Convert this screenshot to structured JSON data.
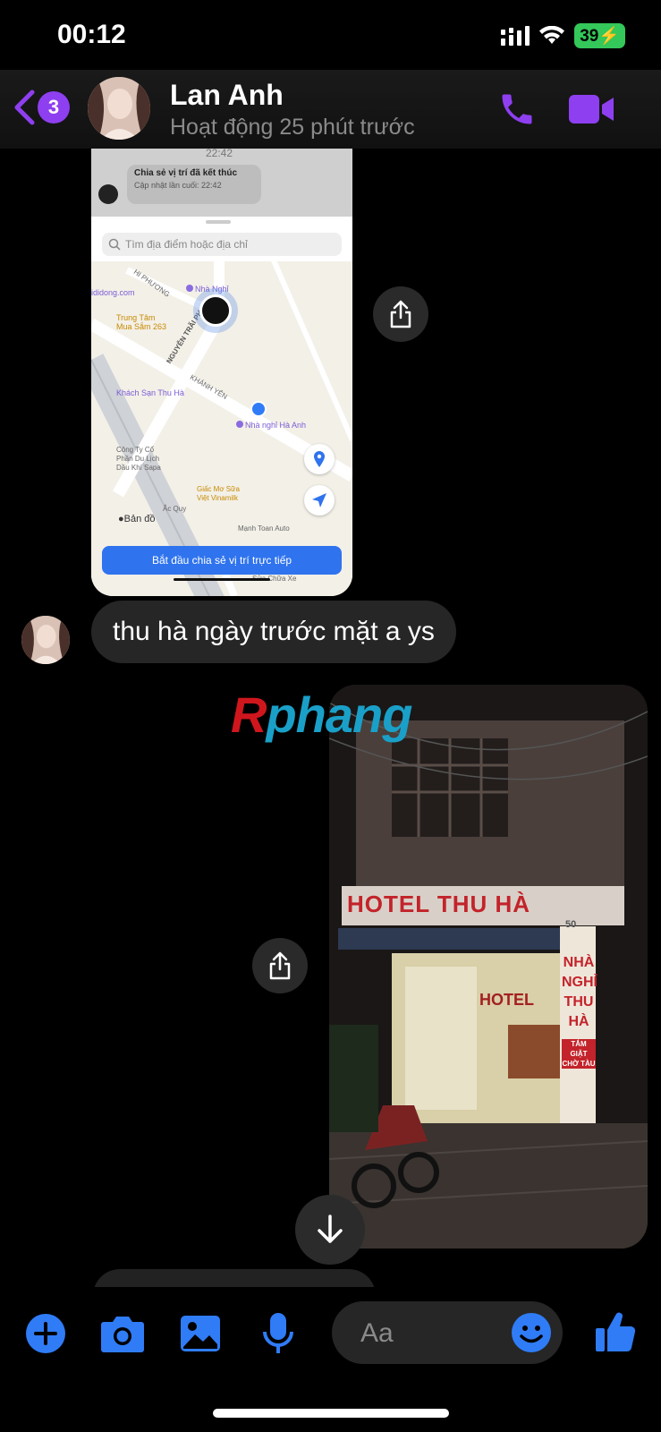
{
  "status_bar": {
    "time": "00:12",
    "battery": "39"
  },
  "header": {
    "back_badge": "3",
    "contact_name": "Lan Anh",
    "activity": "Hoạt động 25 phút trước"
  },
  "location_card": {
    "top_time": "22:42",
    "share_ended_title": "Chia sẻ vị trí đã kết thúc",
    "share_ended_sub": "Cập nhật lần cuối: 22:42",
    "search_placeholder": "Tìm địa điểm hoặc địa chỉ",
    "map_labels": {
      "street_top": "HI PHƯƠNG",
      "nha_nghi": "Nhà Nghỉ",
      "didong": "ididong.com",
      "trung_tam": "Trung Tâm",
      "mua_sam": "Mua Sắm 263",
      "nguyen_trai": "NGUYỄN TRÃI PH",
      "khach_san": "Khách Sạn Thu Hà",
      "khanh_yen": "KHÁNH YÊN",
      "nha_nghi_ha_anh": "Nhà nghỉ Hà Anh",
      "cong_ty_1": "Công Ty Cổ",
      "cong_ty_2": "Phần Du Lịch",
      "cong_ty_3": "Dầu Khí Sapa",
      "giac_mo_1": "Giấc Mơ Sữa",
      "giac_mo_2": "Việt Vinamilk",
      "ac_quy": "Ắc Quy",
      "ban_do": "Bản đồ",
      "manh_toan": "Mạnh Toan Auto",
      "sua_chua": "Sửa Chữa Xe"
    },
    "live_button": "Bắt đầu chia sẻ vị trí trực tiếp"
  },
  "message": {
    "text": "thu hà ngày trước mặt a ys"
  },
  "watermark": {
    "part1": "R",
    "part2": "phang"
  },
  "photo": {
    "sign_main": "HOTEL THU HÀ",
    "sign_inner": "HOTEL",
    "vertical_sign": [
      "NHÀ",
      "NGHỈ",
      "THU",
      "HÀ"
    ],
    "vertical_sub": [
      "TẮM GIẶT",
      "CHỜ TÀU"
    ],
    "address_number": "50"
  },
  "composer": {
    "placeholder": "Aa"
  },
  "colors": {
    "accent_purple": "#8e3ff0",
    "accent_blue": "#2f7cf6",
    "map_button": "#2f73ee"
  }
}
